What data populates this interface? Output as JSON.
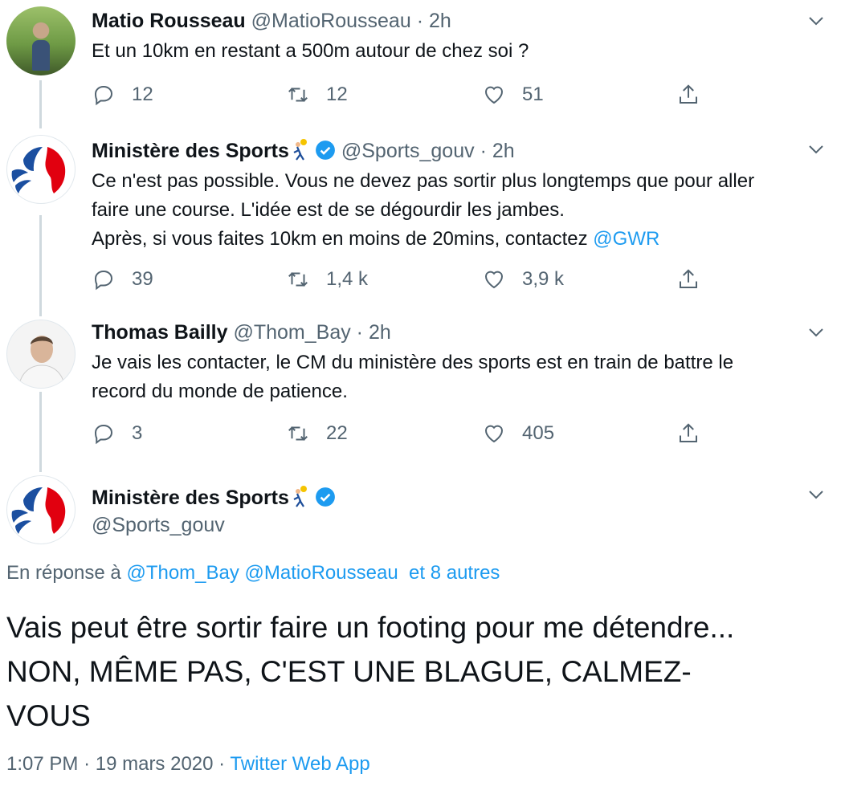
{
  "tweets": [
    {
      "name": "Matio Rousseau",
      "handle": "@MatioRousseau",
      "sep": "·",
      "time": "2h",
      "text": "Et un 10km en restant a 500m autour de chez soi ?",
      "replies": "12",
      "retweets": "12",
      "likes": "51"
    },
    {
      "name": "Ministère des Sports",
      "handle": "@Sports_gouv",
      "sep": "·",
      "time": "2h",
      "text_lines": [
        "Ce n'est pas possible. Vous ne devez pas sortir plus longtemps que pour aller",
        "faire une course. L'idée est de se dégourdir les jambes.",
        "Après, si vous faites 10km en moins de 20mins, contactez "
      ],
      "mention": "@GWR",
      "replies": "39",
      "retweets": "1,4 k",
      "likes": "3,9 k"
    },
    {
      "name": "Thomas Bailly",
      "handle": "@Thom_Bay",
      "sep": "·",
      "time": "2h",
      "text_lines": [
        "Je vais les contacter, le CM du ministère des sports est en train de battre le",
        "record du monde de patience."
      ],
      "replies": "3",
      "retweets": "22",
      "likes": "405"
    }
  ],
  "main_tweet": {
    "name": "Ministère des Sports",
    "handle": "@Sports_gouv",
    "reply_prefix": "En réponse à",
    "reply_mentions": [
      "@Thom_Bay",
      "@MatioRousseau"
    ],
    "reply_others": "et 8 autres",
    "text_lines": [
      "Vais peut être sortir faire un footing pour me détendre...",
      "NON, MÊME PAS, C'EST UNE BLAGUE, CALMEZ-",
      "VOUS"
    ],
    "time": "1:07 PM",
    "sep1": "·",
    "date": "19 mars 2020",
    "sep2": "·",
    "source": "Twitter Web App"
  },
  "icons": {
    "reply": "reply-icon",
    "retweet": "retweet-icon",
    "like": "heart-icon",
    "share": "share-icon",
    "more": "chevron-down-icon",
    "verified": "verified-badge-icon",
    "emoji": "handball-emoji-icon"
  },
  "colors": {
    "text": "#0f1419",
    "secondary": "#536471",
    "link": "#1d9bf0",
    "thread_line": "#cfd9de",
    "verified": "#1d9bf0"
  }
}
